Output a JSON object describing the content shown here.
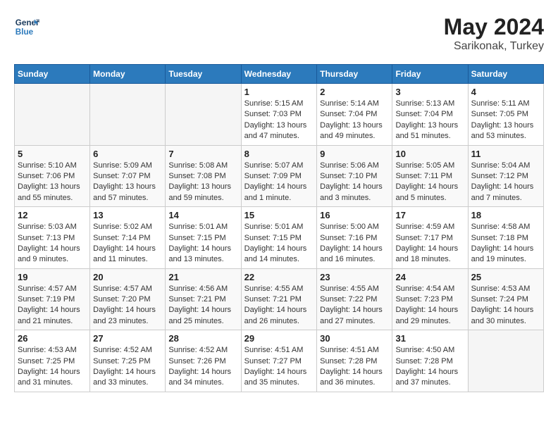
{
  "header": {
    "logo_line1": "General",
    "logo_line2": "Blue",
    "month_year": "May 2024",
    "location": "Sarikonak, Turkey"
  },
  "weekdays": [
    "Sunday",
    "Monday",
    "Tuesday",
    "Wednesday",
    "Thursday",
    "Friday",
    "Saturday"
  ],
  "weeks": [
    [
      {
        "day": "",
        "sunrise": "",
        "sunset": "",
        "daylight": ""
      },
      {
        "day": "",
        "sunrise": "",
        "sunset": "",
        "daylight": ""
      },
      {
        "day": "",
        "sunrise": "",
        "sunset": "",
        "daylight": ""
      },
      {
        "day": "1",
        "sunrise": "Sunrise: 5:15 AM",
        "sunset": "Sunset: 7:03 PM",
        "daylight": "Daylight: 13 hours and 47 minutes."
      },
      {
        "day": "2",
        "sunrise": "Sunrise: 5:14 AM",
        "sunset": "Sunset: 7:04 PM",
        "daylight": "Daylight: 13 hours and 49 minutes."
      },
      {
        "day": "3",
        "sunrise": "Sunrise: 5:13 AM",
        "sunset": "Sunset: 7:04 PM",
        "daylight": "Daylight: 13 hours and 51 minutes."
      },
      {
        "day": "4",
        "sunrise": "Sunrise: 5:11 AM",
        "sunset": "Sunset: 7:05 PM",
        "daylight": "Daylight: 13 hours and 53 minutes."
      }
    ],
    [
      {
        "day": "5",
        "sunrise": "Sunrise: 5:10 AM",
        "sunset": "Sunset: 7:06 PM",
        "daylight": "Daylight: 13 hours and 55 minutes."
      },
      {
        "day": "6",
        "sunrise": "Sunrise: 5:09 AM",
        "sunset": "Sunset: 7:07 PM",
        "daylight": "Daylight: 13 hours and 57 minutes."
      },
      {
        "day": "7",
        "sunrise": "Sunrise: 5:08 AM",
        "sunset": "Sunset: 7:08 PM",
        "daylight": "Daylight: 13 hours and 59 minutes."
      },
      {
        "day": "8",
        "sunrise": "Sunrise: 5:07 AM",
        "sunset": "Sunset: 7:09 PM",
        "daylight": "Daylight: 14 hours and 1 minute."
      },
      {
        "day": "9",
        "sunrise": "Sunrise: 5:06 AM",
        "sunset": "Sunset: 7:10 PM",
        "daylight": "Daylight: 14 hours and 3 minutes."
      },
      {
        "day": "10",
        "sunrise": "Sunrise: 5:05 AM",
        "sunset": "Sunset: 7:11 PM",
        "daylight": "Daylight: 14 hours and 5 minutes."
      },
      {
        "day": "11",
        "sunrise": "Sunrise: 5:04 AM",
        "sunset": "Sunset: 7:12 PM",
        "daylight": "Daylight: 14 hours and 7 minutes."
      }
    ],
    [
      {
        "day": "12",
        "sunrise": "Sunrise: 5:03 AM",
        "sunset": "Sunset: 7:13 PM",
        "daylight": "Daylight: 14 hours and 9 minutes."
      },
      {
        "day": "13",
        "sunrise": "Sunrise: 5:02 AM",
        "sunset": "Sunset: 7:14 PM",
        "daylight": "Daylight: 14 hours and 11 minutes."
      },
      {
        "day": "14",
        "sunrise": "Sunrise: 5:01 AM",
        "sunset": "Sunset: 7:15 PM",
        "daylight": "Daylight: 14 hours and 13 minutes."
      },
      {
        "day": "15",
        "sunrise": "Sunrise: 5:01 AM",
        "sunset": "Sunset: 7:15 PM",
        "daylight": "Daylight: 14 hours and 14 minutes."
      },
      {
        "day": "16",
        "sunrise": "Sunrise: 5:00 AM",
        "sunset": "Sunset: 7:16 PM",
        "daylight": "Daylight: 14 hours and 16 minutes."
      },
      {
        "day": "17",
        "sunrise": "Sunrise: 4:59 AM",
        "sunset": "Sunset: 7:17 PM",
        "daylight": "Daylight: 14 hours and 18 minutes."
      },
      {
        "day": "18",
        "sunrise": "Sunrise: 4:58 AM",
        "sunset": "Sunset: 7:18 PM",
        "daylight": "Daylight: 14 hours and 19 minutes."
      }
    ],
    [
      {
        "day": "19",
        "sunrise": "Sunrise: 4:57 AM",
        "sunset": "Sunset: 7:19 PM",
        "daylight": "Daylight: 14 hours and 21 minutes."
      },
      {
        "day": "20",
        "sunrise": "Sunrise: 4:57 AM",
        "sunset": "Sunset: 7:20 PM",
        "daylight": "Daylight: 14 hours and 23 minutes."
      },
      {
        "day": "21",
        "sunrise": "Sunrise: 4:56 AM",
        "sunset": "Sunset: 7:21 PM",
        "daylight": "Daylight: 14 hours and 25 minutes."
      },
      {
        "day": "22",
        "sunrise": "Sunrise: 4:55 AM",
        "sunset": "Sunset: 7:21 PM",
        "daylight": "Daylight: 14 hours and 26 minutes."
      },
      {
        "day": "23",
        "sunrise": "Sunrise: 4:55 AM",
        "sunset": "Sunset: 7:22 PM",
        "daylight": "Daylight: 14 hours and 27 minutes."
      },
      {
        "day": "24",
        "sunrise": "Sunrise: 4:54 AM",
        "sunset": "Sunset: 7:23 PM",
        "daylight": "Daylight: 14 hours and 29 minutes."
      },
      {
        "day": "25",
        "sunrise": "Sunrise: 4:53 AM",
        "sunset": "Sunset: 7:24 PM",
        "daylight": "Daylight: 14 hours and 30 minutes."
      }
    ],
    [
      {
        "day": "26",
        "sunrise": "Sunrise: 4:53 AM",
        "sunset": "Sunset: 7:25 PM",
        "daylight": "Daylight: 14 hours and 31 minutes."
      },
      {
        "day": "27",
        "sunrise": "Sunrise: 4:52 AM",
        "sunset": "Sunset: 7:25 PM",
        "daylight": "Daylight: 14 hours and 33 minutes."
      },
      {
        "day": "28",
        "sunrise": "Sunrise: 4:52 AM",
        "sunset": "Sunset: 7:26 PM",
        "daylight": "Daylight: 14 hours and 34 minutes."
      },
      {
        "day": "29",
        "sunrise": "Sunrise: 4:51 AM",
        "sunset": "Sunset: 7:27 PM",
        "daylight": "Daylight: 14 hours and 35 minutes."
      },
      {
        "day": "30",
        "sunrise": "Sunrise: 4:51 AM",
        "sunset": "Sunset: 7:28 PM",
        "daylight": "Daylight: 14 hours and 36 minutes."
      },
      {
        "day": "31",
        "sunrise": "Sunrise: 4:50 AM",
        "sunset": "Sunset: 7:28 PM",
        "daylight": "Daylight: 14 hours and 37 minutes."
      },
      {
        "day": "",
        "sunrise": "",
        "sunset": "",
        "daylight": ""
      }
    ]
  ]
}
